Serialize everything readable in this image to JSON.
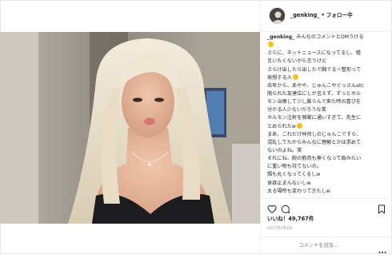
{
  "header": {
    "username": "_genking_",
    "separator": "•",
    "follow_status": "フォロー中"
  },
  "caption": {
    "username": "_genking_",
    "lines": [
      "みんなのコメントとDMうける",
      "さらに、ネットニュースになってるし、嘘",
      "言いたくないから言うけど",
      "さらけ出したら出したで胸でる＝整形って",
      "発想する人",
      "去年から、あやや、じゅんこやぐっさんetc",
      "限られた友達位にしか言えず、ずっとホル",
      "モン治療して少し膨らんで来た時の喜びを",
      "分かる人少ないだろうな笑",
      "ホルモン注射を頻繁に通いすぎて、先生に",
      "とめられたw",
      "まあ、これだけ仲良しのじゅんこですら、",
      "混乱してたからみんなに理解とかは求めて",
      "ないのよね。笑",
      "それにね、腕の筋肉も無くなって肩みたい",
      "に重い物も持てないの。",
      "顔も丸くなってくるしw",
      "食欲止まんないしw",
      "太る場所も変わってきたしw"
    ]
  },
  "likes": "いいね！49,767件",
  "date": "2017年2月1日",
  "comment": {
    "placeholder": "コメントを追加..."
  },
  "icons": [
    "heart-icon",
    "comment-icon",
    "bookmark-icon",
    "more-icon"
  ]
}
